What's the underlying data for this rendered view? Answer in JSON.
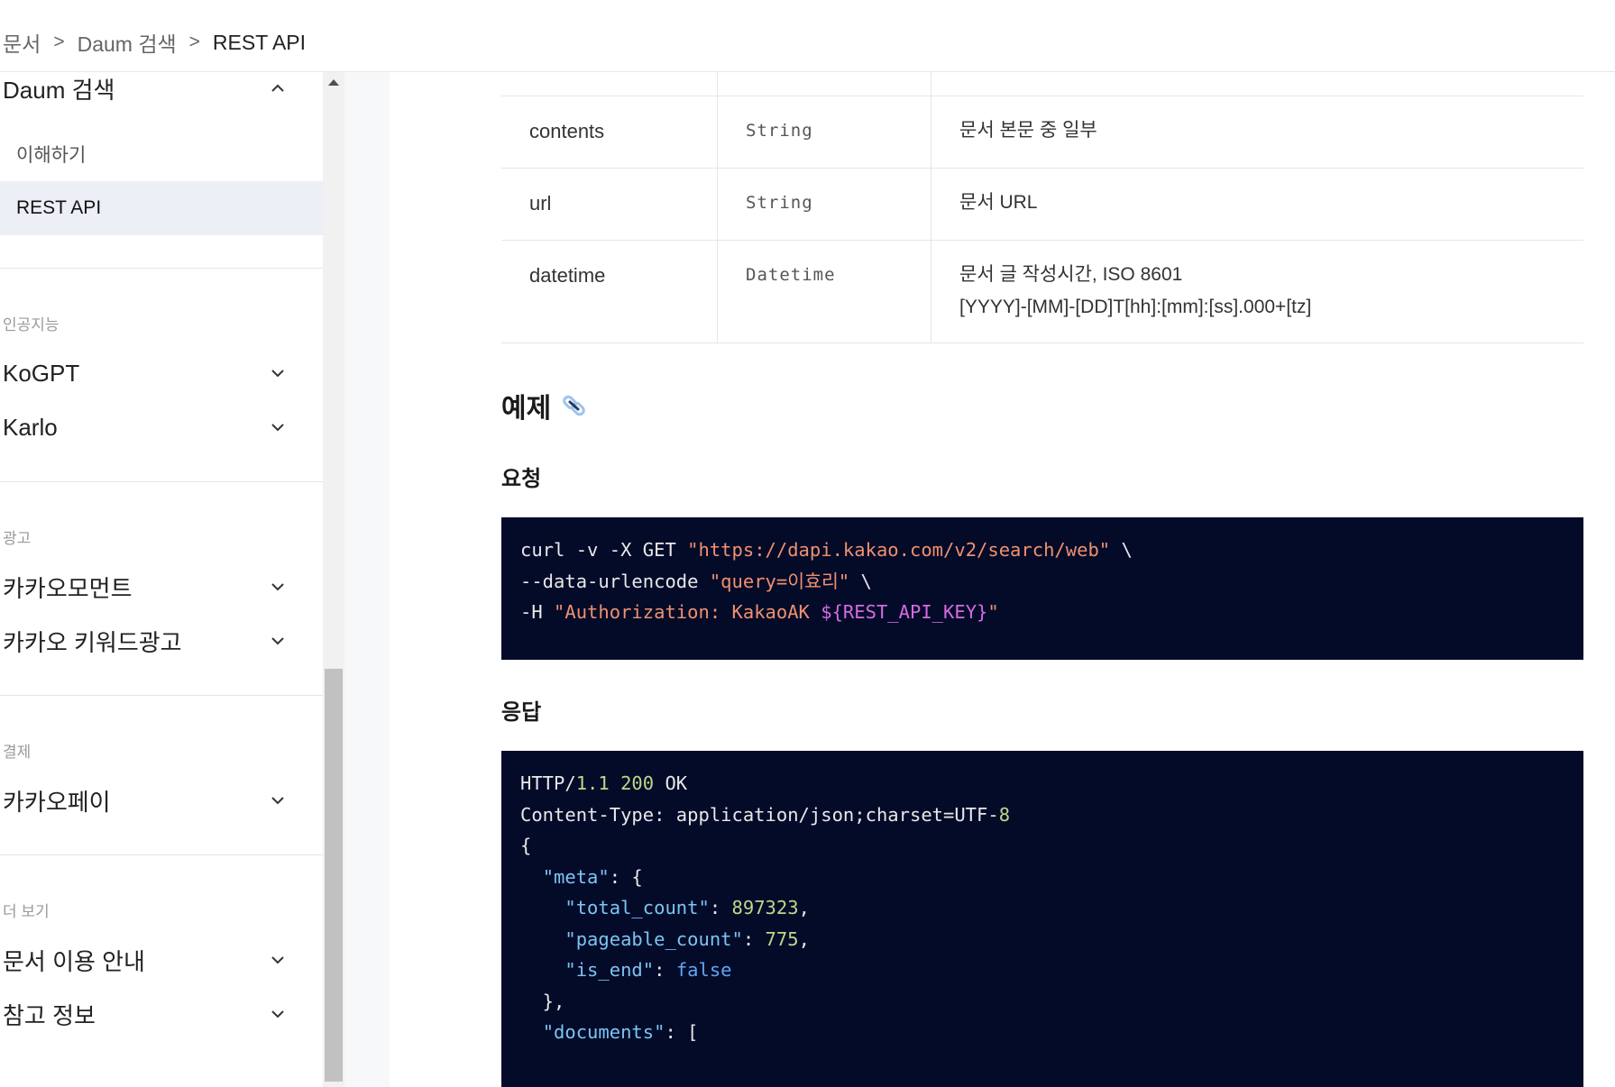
{
  "breadcrumb": {
    "items": [
      "문서",
      "Daum 검색",
      "REST API"
    ],
    "separator": ">"
  },
  "sidebar": {
    "daum_group": {
      "label": "Daum 검색",
      "children": [
        {
          "label": "이해하기",
          "active": false
        },
        {
          "label": "REST API",
          "active": true
        }
      ]
    },
    "sections": [
      {
        "title": "인공지능",
        "items": [
          "KoGPT",
          "Karlo"
        ]
      },
      {
        "title": "광고",
        "items": [
          "카카오모먼트",
          "카카오 키워드광고"
        ]
      },
      {
        "title": "결제",
        "items": [
          "카카오페이"
        ]
      },
      {
        "title": "더 보기",
        "items": [
          "문서 이용 안내",
          "참고 정보"
        ]
      }
    ]
  },
  "table": {
    "rows": [
      {
        "name": "contents",
        "type": "String",
        "desc": [
          "문서 본문 중 일부"
        ]
      },
      {
        "name": "url",
        "type": "String",
        "desc": [
          "문서 URL"
        ]
      },
      {
        "name": "datetime",
        "type": "Datetime",
        "desc": [
          "문서 글 작성시간, ISO 8601",
          "[YYYY]-[MM]-[DD]T[hh]:[mm]:[ss].000+[tz]"
        ]
      }
    ]
  },
  "example": {
    "heading": "예제",
    "request_heading": "요청",
    "response_heading": "응답"
  },
  "request_code": [
    [
      {
        "t": "curl -v -X GET ",
        "c": "plain"
      },
      {
        "t": "\"https://dapi.kakao.com/v2/search/web\"",
        "c": "str"
      },
      {
        "t": " \\",
        "c": "plain"
      }
    ],
    [
      {
        "t": "--data-urlencode ",
        "c": "plain"
      },
      {
        "t": "\"query=이효리\"",
        "c": "str"
      },
      {
        "t": " \\",
        "c": "plain"
      }
    ],
    [
      {
        "t": "-H ",
        "c": "plain"
      },
      {
        "t": "\"Authorization: KakaoAK ",
        "c": "str"
      },
      {
        "t": "${REST_API_KEY}",
        "c": "var"
      },
      {
        "t": "\"",
        "c": "str"
      }
    ]
  ],
  "response_code": [
    [
      {
        "t": "HTTP/",
        "c": "plain"
      },
      {
        "t": "1.1",
        "c": "num"
      },
      {
        "t": " ",
        "c": "plain"
      },
      {
        "t": "200",
        "c": "num"
      },
      {
        "t": " OK",
        "c": "plain"
      }
    ],
    [
      {
        "t": "Content-Type: application/json;charset=UTF-",
        "c": "plain"
      },
      {
        "t": "8",
        "c": "num"
      }
    ],
    [
      {
        "t": "{",
        "c": "plain"
      }
    ],
    [
      {
        "t": "  ",
        "c": "plain"
      },
      {
        "t": "\"meta\"",
        "c": "key"
      },
      {
        "t": ": {",
        "c": "plain"
      }
    ],
    [
      {
        "t": "    ",
        "c": "plain"
      },
      {
        "t": "\"total_count\"",
        "c": "key"
      },
      {
        "t": ": ",
        "c": "plain"
      },
      {
        "t": "897323",
        "c": "num"
      },
      {
        "t": ",",
        "c": "plain"
      }
    ],
    [
      {
        "t": "    ",
        "c": "plain"
      },
      {
        "t": "\"pageable_count\"",
        "c": "key"
      },
      {
        "t": ": ",
        "c": "plain"
      },
      {
        "t": "775",
        "c": "num"
      },
      {
        "t": ",",
        "c": "plain"
      }
    ],
    [
      {
        "t": "    ",
        "c": "plain"
      },
      {
        "t": "\"is_end\"",
        "c": "key"
      },
      {
        "t": ": ",
        "c": "plain"
      },
      {
        "t": "false",
        "c": "kw"
      }
    ],
    [
      {
        "t": "  },",
        "c": "plain"
      }
    ],
    [
      {
        "t": "  ",
        "c": "plain"
      },
      {
        "t": "\"documents\"",
        "c": "key"
      },
      {
        "t": ": [",
        "c": "plain"
      }
    ]
  ],
  "colors": {
    "code_bg": "#040b29",
    "active_nav_bg": "#eceff5",
    "string": "#f0906e",
    "variable": "#d56be0",
    "number": "#b9d98a",
    "key": "#7cc4f2",
    "keyword": "#5ea6f5"
  },
  "icons": {
    "chevron_up": "chevron-up-icon",
    "chevron_down": "chevron-down-icon",
    "link": "link-icon"
  }
}
